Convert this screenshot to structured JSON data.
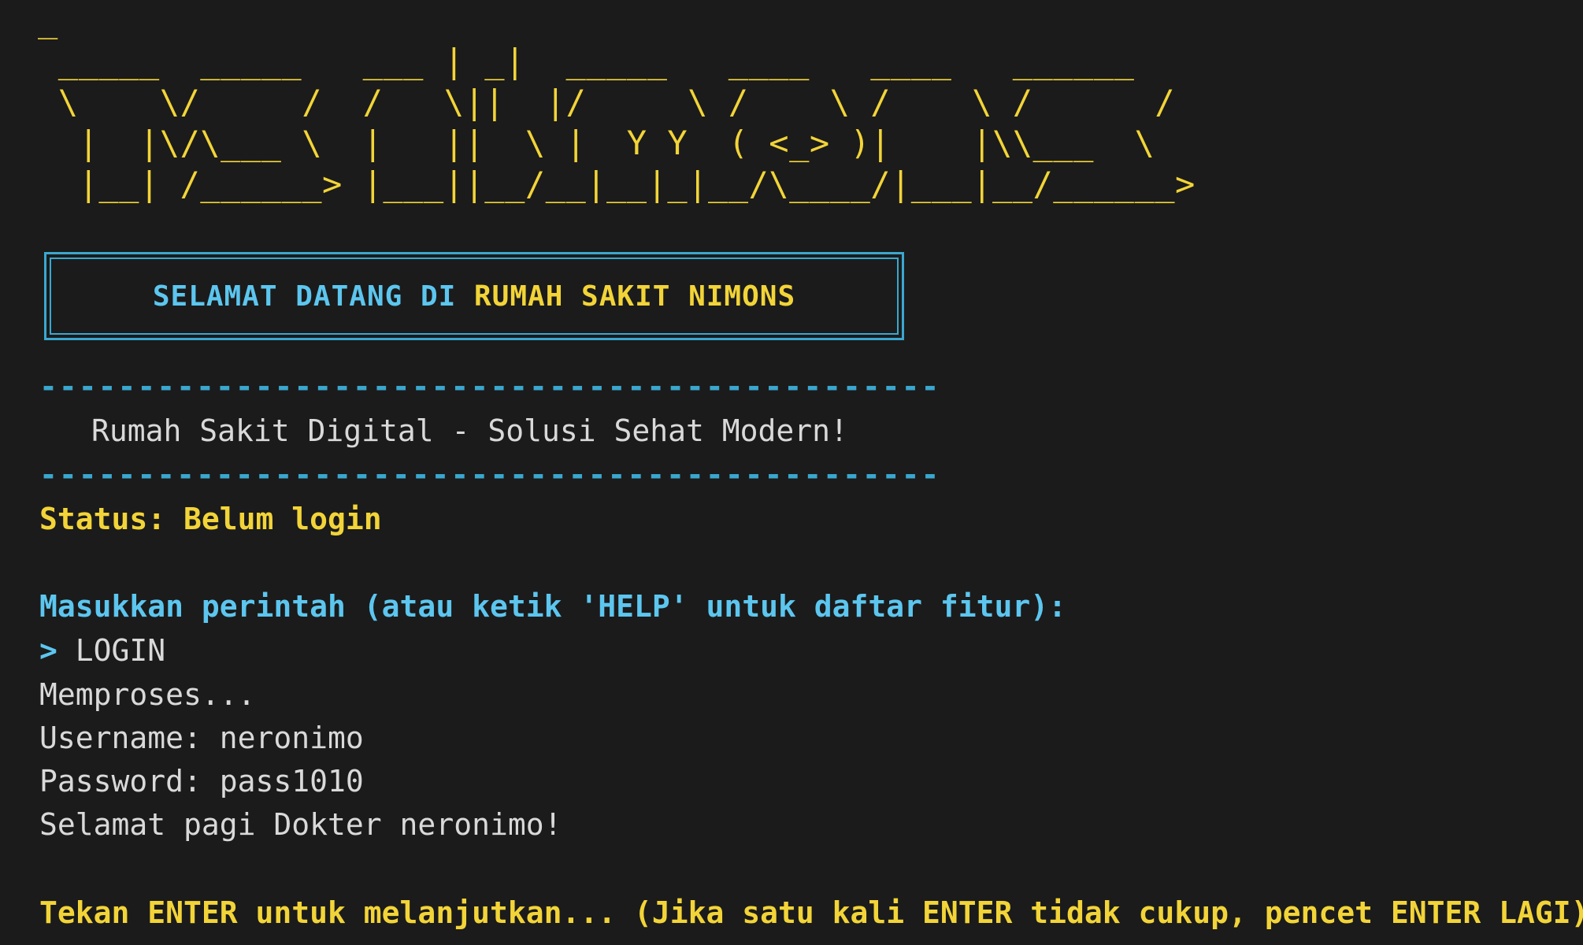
{
  "ascii_logo": "_\n _____  _____   ___ | _|  _____   ____   ____   ______\n \\    \\/     /  /   \\||  |/     \\ /    \\ /    \\ /      /\n  |  |\\/\\___ \\  |   ||  \\ |  Y Y  ( <_> )|    |\\\\___  \\\n  |__| /______> |___||__/__|__|_|__/\\____/|___|__/______>",
  "banner": {
    "part1": "SELAMAT DATANG DI ",
    "part2": "RUMAH SAKIT NIMONS"
  },
  "divider": "----------------------------------------------",
  "tagline": "Rumah Sakit Digital - Solusi Sehat Modern!",
  "status": "Status: Belum login",
  "prompt_info": "Masukkan perintah (atau ketik 'HELP' untuk daftar fitur):",
  "command": {
    "caret": "> ",
    "text": "LOGIN"
  },
  "output": {
    "processing": "Memproses...",
    "username_line": "Username: neronimo",
    "password_line": "Password: pass1010",
    "greeting": "Selamat pagi Dokter neronimo!"
  },
  "continue_prompt": "Tekan ENTER untuk melanjutkan... (Jika satu kali ENTER tidak cukup, pencet ENTER LAGI)",
  "colors": {
    "background": "#1b1b1b",
    "yellow": "#f2d438",
    "cyan": "#5cc6ef",
    "blue": "#3aa7cf",
    "text": "#d9d9d9"
  }
}
